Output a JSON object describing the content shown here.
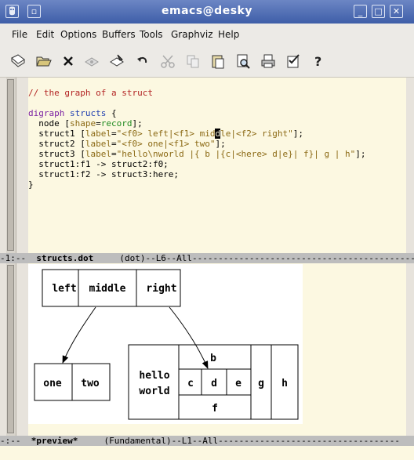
{
  "window": {
    "title": "emacs@desky"
  },
  "menu": [
    "File",
    "Edit",
    "Options",
    "Buffers",
    "Tools",
    "Graphviz",
    "Help"
  ],
  "toolbar_icons": [
    "new-file-icon",
    "open-folder-icon",
    "close-icon",
    "save-icon",
    "save-as-icon",
    "undo-icon",
    "cut-icon",
    "copy-icon",
    "paste-icon",
    "search-icon",
    "print-icon",
    "preferences-icon",
    "help-icon"
  ],
  "editor": {
    "comment": "// the graph of a struct",
    "kw_digraph": "digraph",
    "name": "structs",
    "lines": {
      "l3_node": "  node [",
      "l3_attr": "shape",
      "l3_eq": "=",
      "l3_val": "record",
      "l3_end": "];",
      "s1_a": "  struct1 [",
      "s1_attr": "label",
      "s1_str_a": "\"<f0> left|<f1> mid",
      "s1_cursor": "d",
      "s1_str_b": "le|<f2> right\"",
      "s1_end": "];",
      "s2_a": "  struct2 [",
      "s2_attr": "label",
      "s2_str": "\"<f0> one|<f1> two\"",
      "s2_end": "];",
      "s3_a": "  struct3 [",
      "s3_attr": "label",
      "s3_str": "\"hello\\nworld |{ b |{c|<here> d|e}| f}| g | h\"",
      "s3_end": "];",
      "e1": "  struct1:f1 -> struct2:f0;",
      "e2": "  struct1:f2 -> struct3:here;",
      "close": "}"
    }
  },
  "modeline_top": {
    "prefix": "-1:--  ",
    "buffer": "structs.dot",
    "rest": "     (dot)--L6--All-------------------------------------------"
  },
  "modeline_bottom": {
    "prefix": "-:--  ",
    "buffer": "*preview*",
    "rest": "     (Fundamental)--L1--All-----------------------------------"
  },
  "graph": {
    "struct1": [
      "left",
      "middle",
      "right"
    ],
    "struct2": [
      "one",
      "two"
    ],
    "struct3": {
      "hello": "hello",
      "world": "world",
      "b": "b",
      "c": "c",
      "d": "d",
      "e": "e",
      "f": "f",
      "g": "g",
      "h": "h"
    }
  }
}
